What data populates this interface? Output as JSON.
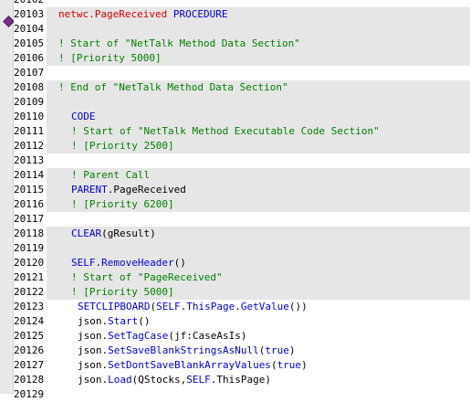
{
  "editor": {
    "lines": [
      {
        "num": "20102",
        "shade": false,
        "indent": 0,
        "tokens": []
      },
      {
        "num": "20103",
        "shade": true,
        "indent": 0,
        "tokens": [
          {
            "t": "netwc.PageReceived",
            "c": "red"
          },
          {
            "t": " PROCEDURE",
            "c": "kw"
          }
        ]
      },
      {
        "num": "20104",
        "shade": true,
        "indent": 0,
        "tokens": []
      },
      {
        "num": "20105",
        "shade": true,
        "indent": 0,
        "tokens": [
          {
            "t": "! Start of \"NetTalk Method Data Section\"",
            "c": "cm"
          }
        ]
      },
      {
        "num": "20106",
        "shade": true,
        "indent": 0,
        "tokens": [
          {
            "t": "! [Priority 5000]",
            "c": "cm"
          }
        ]
      },
      {
        "num": "20107",
        "shade": false,
        "indent": 0,
        "tokens": []
      },
      {
        "num": "20108",
        "shade": true,
        "indent": 0,
        "tokens": [
          {
            "t": "! End of \"NetTalk Method Data Section\"",
            "c": "cm"
          }
        ]
      },
      {
        "num": "20109",
        "shade": true,
        "indent": 0,
        "tokens": []
      },
      {
        "num": "20110",
        "shade": true,
        "indent": 2,
        "tokens": [
          {
            "t": "CODE",
            "c": "kw"
          }
        ]
      },
      {
        "num": "20111",
        "shade": true,
        "indent": 2,
        "tokens": [
          {
            "t": "! Start of \"NetTalk Method Executable Code Section\"",
            "c": "cm"
          }
        ]
      },
      {
        "num": "20112",
        "shade": true,
        "indent": 2,
        "tokens": [
          {
            "t": "! [Priority 2500]",
            "c": "cm"
          }
        ]
      },
      {
        "num": "20113",
        "shade": false,
        "indent": 0,
        "tokens": []
      },
      {
        "num": "20114",
        "shade": true,
        "indent": 2,
        "tokens": [
          {
            "t": "! Parent Call",
            "c": "cm"
          }
        ]
      },
      {
        "num": "20115",
        "shade": true,
        "indent": 2,
        "tokens": [
          {
            "t": "PARENT",
            "c": "kw"
          },
          {
            "t": ".PageReceived",
            "c": "tx"
          }
        ]
      },
      {
        "num": "20116",
        "shade": true,
        "indent": 2,
        "tokens": [
          {
            "t": "! [Priority 6200]",
            "c": "cm"
          }
        ]
      },
      {
        "num": "20117",
        "shade": false,
        "indent": 0,
        "tokens": []
      },
      {
        "num": "20118",
        "shade": true,
        "indent": 2,
        "tokens": [
          {
            "t": "CLEAR",
            "c": "kw"
          },
          {
            "t": "(gResult)",
            "c": "tx"
          }
        ]
      },
      {
        "num": "20119",
        "shade": true,
        "indent": 0,
        "tokens": []
      },
      {
        "num": "20120",
        "shade": true,
        "indent": 2,
        "tokens": [
          {
            "t": "SELF",
            "c": "kw"
          },
          {
            "t": ".",
            "c": "tx"
          },
          {
            "t": "RemoveHeader",
            "c": "kw"
          },
          {
            "t": "()",
            "c": "tx"
          }
        ]
      },
      {
        "num": "20121",
        "shade": true,
        "indent": 2,
        "tokens": [
          {
            "t": "! Start of \"PageReceived\"",
            "c": "cm"
          }
        ]
      },
      {
        "num": "20122",
        "shade": true,
        "indent": 2,
        "tokens": [
          {
            "t": "! [Priority 5000]",
            "c": "cm"
          }
        ]
      },
      {
        "num": "20123",
        "shade": false,
        "indent": 3,
        "tokens": [
          {
            "t": "SETCLIPBOARD",
            "c": "kw"
          },
          {
            "t": "(",
            "c": "tx"
          },
          {
            "t": "SELF",
            "c": "kw"
          },
          {
            "t": ".",
            "c": "tx"
          },
          {
            "t": "ThisPage",
            "c": "kw"
          },
          {
            "t": ".",
            "c": "tx"
          },
          {
            "t": "GetValue",
            "c": "kw"
          },
          {
            "t": "())",
            "c": "tx"
          }
        ]
      },
      {
        "num": "20124",
        "shade": false,
        "indent": 3,
        "tokens": [
          {
            "t": "json.",
            "c": "tx"
          },
          {
            "t": "Start",
            "c": "kw"
          },
          {
            "t": "()",
            "c": "tx"
          }
        ]
      },
      {
        "num": "20125",
        "shade": false,
        "indent": 3,
        "tokens": [
          {
            "t": "json.",
            "c": "tx"
          },
          {
            "t": "SetTagCase",
            "c": "kw"
          },
          {
            "t": "(jf:CaseAsIs)",
            "c": "tx"
          }
        ]
      },
      {
        "num": "20126",
        "shade": false,
        "indent": 3,
        "tokens": [
          {
            "t": "json.",
            "c": "tx"
          },
          {
            "t": "SetSaveBlankStringsAsNull",
            "c": "kw"
          },
          {
            "t": "(",
            "c": "tx"
          },
          {
            "t": "true",
            "c": "kw"
          },
          {
            "t": ")",
            "c": "tx"
          }
        ]
      },
      {
        "num": "20127",
        "shade": false,
        "indent": 3,
        "tokens": [
          {
            "t": "json.",
            "c": "tx"
          },
          {
            "t": "SetDontSaveBlankArrayValues",
            "c": "kw"
          },
          {
            "t": "(",
            "c": "tx"
          },
          {
            "t": "true",
            "c": "kw"
          },
          {
            "t": ")",
            "c": "tx"
          }
        ]
      },
      {
        "num": "20128",
        "shade": false,
        "indent": 3,
        "tokens": [
          {
            "t": "json.",
            "c": "tx"
          },
          {
            "t": "Load",
            "c": "kw"
          },
          {
            "t": "(QStocks,",
            "c": "tx"
          },
          {
            "t": "SELF",
            "c": "kw"
          },
          {
            "t": ".ThisPage)",
            "c": "tx"
          }
        ]
      },
      {
        "num": "20129",
        "shade": false,
        "indent": 0,
        "tokens": []
      }
    ],
    "marker_line": "20103",
    "marker_icon": "breakpoint-diamond-icon"
  }
}
